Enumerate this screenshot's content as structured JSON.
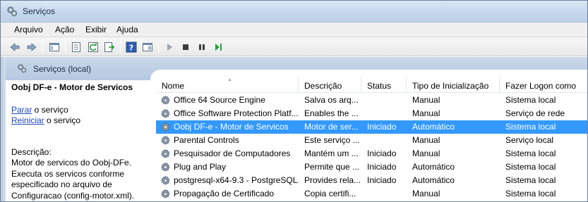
{
  "window": {
    "title": "Serviços",
    "title_icon": "gears-icon"
  },
  "menu": [
    "Arquivo",
    "Ação",
    "Exibir",
    "Ajuda"
  ],
  "toolbar": {
    "buttons": [
      "back-arrow-icon",
      "forward-arrow-icon",
      "show-hide-console-tree-icon",
      "properties-icon",
      "refresh-icon",
      "export-list-icon",
      "help-icon",
      "show-action-pane-icon",
      "start-service-icon",
      "stop-service-icon",
      "pause-service-icon",
      "restart-service-icon"
    ]
  },
  "header": {
    "title": "Serviços (local)"
  },
  "details": {
    "title": "Oobj DF-e - Motor de Servicos",
    "stop_link": "Parar",
    "stop_suffix": " o serviço",
    "restart_link": "Reiniciar",
    "restart_suffix": " o serviço",
    "description_label": "Descrição:",
    "description": "Motor de servicos do Oobj-DFe. Executa os servicos conforme especificado no arquivo de Configuracao (config-motor.xml)."
  },
  "columns": [
    "Nome",
    "Descrição",
    "Status",
    "Tipo de Inicialização",
    "Fazer Logon como"
  ],
  "rows": [
    {
      "name": "Office 64 Source Engine",
      "description": "Salva os arq...",
      "status": "",
      "startup": "Manual",
      "logon": "Sistema local"
    },
    {
      "name": "Office Software Protection Platf...",
      "description": "Enables the ...",
      "status": "",
      "startup": "Manual",
      "logon": "Serviço de rede"
    },
    {
      "name": "Oobj DF-e - Motor de Servicos",
      "description": "Motor de ser...",
      "status": "Iniciado",
      "startup": "Automático",
      "logon": "Sistema local",
      "selected": true
    },
    {
      "name": "Parental Controls",
      "description": "Este serviço ...",
      "status": "",
      "startup": "Manual",
      "logon": "Serviço local"
    },
    {
      "name": "Pesquisador de Computadores",
      "description": "Mantém um ...",
      "status": "Iniciado",
      "startup": "Manual",
      "logon": "Sistema local"
    },
    {
      "name": "Plug and Play",
      "description": "Permite que ...",
      "status": "Iniciado",
      "startup": "Automático",
      "logon": "Sistema local"
    },
    {
      "name": "postgresql-x64-9.3 - PostgreSQL...",
      "description": "Provides rela...",
      "status": "Iniciado",
      "startup": "Automático",
      "logon": "Sistema local"
    },
    {
      "name": "Propagação de Certificado",
      "description": "Copia certifi...",
      "status": "",
      "startup": "Manual",
      "logon": "Sistema local"
    }
  ],
  "colors": {
    "selection": "#3399ff",
    "link": "#2249b6",
    "header_band": "#c9d8ea"
  }
}
